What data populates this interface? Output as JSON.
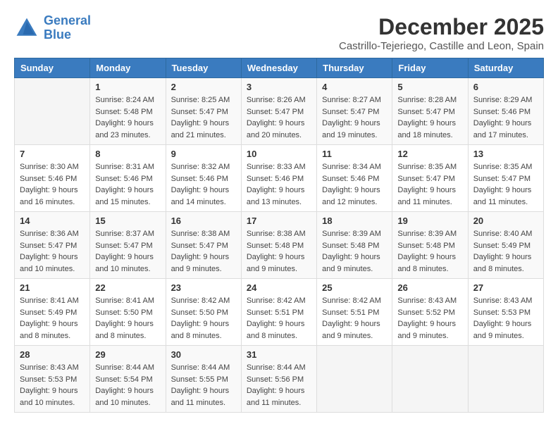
{
  "logo": {
    "line1": "General",
    "line2": "Blue"
  },
  "title": "December 2025",
  "location": "Castrillo-Tejeriego, Castille and Leon, Spain",
  "days_of_week": [
    "Sunday",
    "Monday",
    "Tuesday",
    "Wednesday",
    "Thursday",
    "Friday",
    "Saturday"
  ],
  "weeks": [
    [
      {
        "num": "",
        "sunrise": "",
        "sunset": "",
        "daylight": ""
      },
      {
        "num": "1",
        "sunrise": "Sunrise: 8:24 AM",
        "sunset": "Sunset: 5:48 PM",
        "daylight": "Daylight: 9 hours and 23 minutes."
      },
      {
        "num": "2",
        "sunrise": "Sunrise: 8:25 AM",
        "sunset": "Sunset: 5:47 PM",
        "daylight": "Daylight: 9 hours and 21 minutes."
      },
      {
        "num": "3",
        "sunrise": "Sunrise: 8:26 AM",
        "sunset": "Sunset: 5:47 PM",
        "daylight": "Daylight: 9 hours and 20 minutes."
      },
      {
        "num": "4",
        "sunrise": "Sunrise: 8:27 AM",
        "sunset": "Sunset: 5:47 PM",
        "daylight": "Daylight: 9 hours and 19 minutes."
      },
      {
        "num": "5",
        "sunrise": "Sunrise: 8:28 AM",
        "sunset": "Sunset: 5:47 PM",
        "daylight": "Daylight: 9 hours and 18 minutes."
      },
      {
        "num": "6",
        "sunrise": "Sunrise: 8:29 AM",
        "sunset": "Sunset: 5:46 PM",
        "daylight": "Daylight: 9 hours and 17 minutes."
      }
    ],
    [
      {
        "num": "7",
        "sunrise": "Sunrise: 8:30 AM",
        "sunset": "Sunset: 5:46 PM",
        "daylight": "Daylight: 9 hours and 16 minutes."
      },
      {
        "num": "8",
        "sunrise": "Sunrise: 8:31 AM",
        "sunset": "Sunset: 5:46 PM",
        "daylight": "Daylight: 9 hours and 15 minutes."
      },
      {
        "num": "9",
        "sunrise": "Sunrise: 8:32 AM",
        "sunset": "Sunset: 5:46 PM",
        "daylight": "Daylight: 9 hours and 14 minutes."
      },
      {
        "num": "10",
        "sunrise": "Sunrise: 8:33 AM",
        "sunset": "Sunset: 5:46 PM",
        "daylight": "Daylight: 9 hours and 13 minutes."
      },
      {
        "num": "11",
        "sunrise": "Sunrise: 8:34 AM",
        "sunset": "Sunset: 5:46 PM",
        "daylight": "Daylight: 9 hours and 12 minutes."
      },
      {
        "num": "12",
        "sunrise": "Sunrise: 8:35 AM",
        "sunset": "Sunset: 5:47 PM",
        "daylight": "Daylight: 9 hours and 11 minutes."
      },
      {
        "num": "13",
        "sunrise": "Sunrise: 8:35 AM",
        "sunset": "Sunset: 5:47 PM",
        "daylight": "Daylight: 9 hours and 11 minutes."
      }
    ],
    [
      {
        "num": "14",
        "sunrise": "Sunrise: 8:36 AM",
        "sunset": "Sunset: 5:47 PM",
        "daylight": "Daylight: 9 hours and 10 minutes."
      },
      {
        "num": "15",
        "sunrise": "Sunrise: 8:37 AM",
        "sunset": "Sunset: 5:47 PM",
        "daylight": "Daylight: 9 hours and 10 minutes."
      },
      {
        "num": "16",
        "sunrise": "Sunrise: 8:38 AM",
        "sunset": "Sunset: 5:47 PM",
        "daylight": "Daylight: 9 hours and 9 minutes."
      },
      {
        "num": "17",
        "sunrise": "Sunrise: 8:38 AM",
        "sunset": "Sunset: 5:48 PM",
        "daylight": "Daylight: 9 hours and 9 minutes."
      },
      {
        "num": "18",
        "sunrise": "Sunrise: 8:39 AM",
        "sunset": "Sunset: 5:48 PM",
        "daylight": "Daylight: 9 hours and 9 minutes."
      },
      {
        "num": "19",
        "sunrise": "Sunrise: 8:39 AM",
        "sunset": "Sunset: 5:48 PM",
        "daylight": "Daylight: 9 hours and 8 minutes."
      },
      {
        "num": "20",
        "sunrise": "Sunrise: 8:40 AM",
        "sunset": "Sunset: 5:49 PM",
        "daylight": "Daylight: 9 hours and 8 minutes."
      }
    ],
    [
      {
        "num": "21",
        "sunrise": "Sunrise: 8:41 AM",
        "sunset": "Sunset: 5:49 PM",
        "daylight": "Daylight: 9 hours and 8 minutes."
      },
      {
        "num": "22",
        "sunrise": "Sunrise: 8:41 AM",
        "sunset": "Sunset: 5:50 PM",
        "daylight": "Daylight: 9 hours and 8 minutes."
      },
      {
        "num": "23",
        "sunrise": "Sunrise: 8:42 AM",
        "sunset": "Sunset: 5:50 PM",
        "daylight": "Daylight: 9 hours and 8 minutes."
      },
      {
        "num": "24",
        "sunrise": "Sunrise: 8:42 AM",
        "sunset": "Sunset: 5:51 PM",
        "daylight": "Daylight: 9 hours and 8 minutes."
      },
      {
        "num": "25",
        "sunrise": "Sunrise: 8:42 AM",
        "sunset": "Sunset: 5:51 PM",
        "daylight": "Daylight: 9 hours and 9 minutes."
      },
      {
        "num": "26",
        "sunrise": "Sunrise: 8:43 AM",
        "sunset": "Sunset: 5:52 PM",
        "daylight": "Daylight: 9 hours and 9 minutes."
      },
      {
        "num": "27",
        "sunrise": "Sunrise: 8:43 AM",
        "sunset": "Sunset: 5:53 PM",
        "daylight": "Daylight: 9 hours and 9 minutes."
      }
    ],
    [
      {
        "num": "28",
        "sunrise": "Sunrise: 8:43 AM",
        "sunset": "Sunset: 5:53 PM",
        "daylight": "Daylight: 9 hours and 10 minutes."
      },
      {
        "num": "29",
        "sunrise": "Sunrise: 8:44 AM",
        "sunset": "Sunset: 5:54 PM",
        "daylight": "Daylight: 9 hours and 10 minutes."
      },
      {
        "num": "30",
        "sunrise": "Sunrise: 8:44 AM",
        "sunset": "Sunset: 5:55 PM",
        "daylight": "Daylight: 9 hours and 11 minutes."
      },
      {
        "num": "31",
        "sunrise": "Sunrise: 8:44 AM",
        "sunset": "Sunset: 5:56 PM",
        "daylight": "Daylight: 9 hours and 11 minutes."
      },
      {
        "num": "",
        "sunrise": "",
        "sunset": "",
        "daylight": ""
      },
      {
        "num": "",
        "sunrise": "",
        "sunset": "",
        "daylight": ""
      },
      {
        "num": "",
        "sunrise": "",
        "sunset": "",
        "daylight": ""
      }
    ]
  ]
}
